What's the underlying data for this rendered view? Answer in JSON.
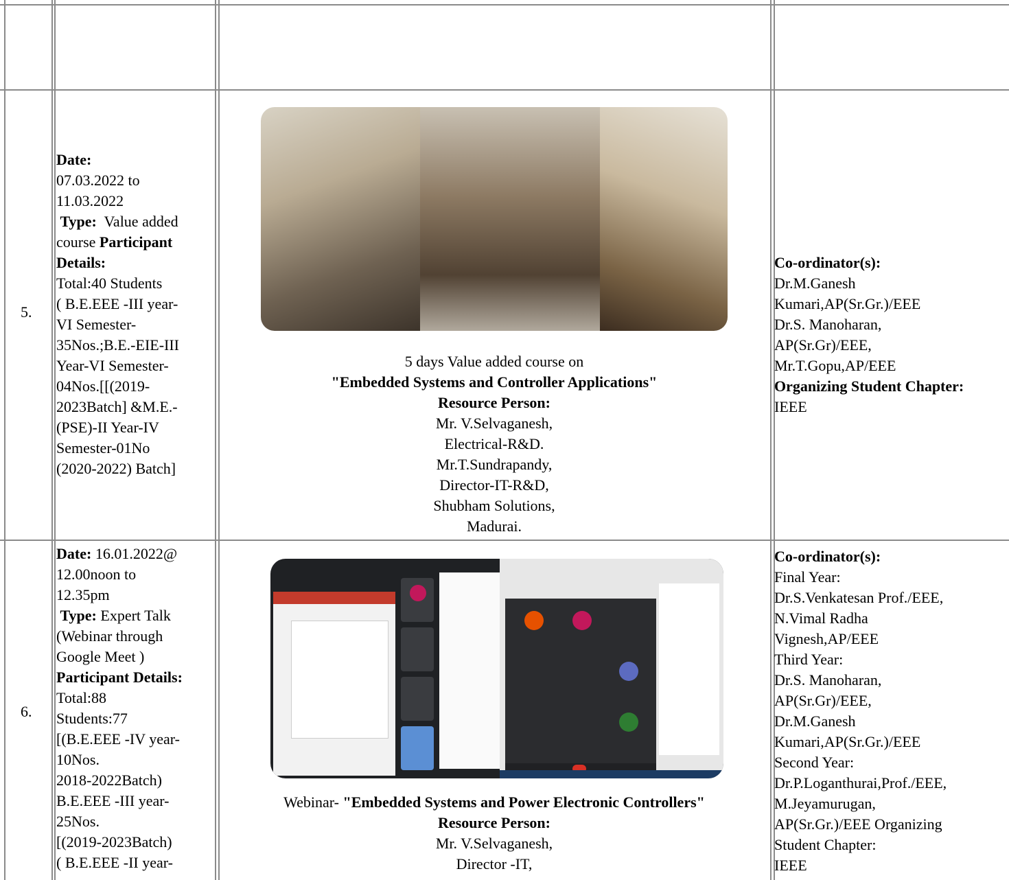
{
  "rows": [
    {
      "sno": "5.",
      "details": {
        "date_label": "Date:",
        "date_lines": [
          "07.03.2022 to",
          "11.03.2022"
        ],
        "type_label": "Type:",
        "type_value": "Value added course",
        "participant_label": "Participant Details:",
        "participant_lines": [
          "Total:40 Students",
          "( B.E.EEE -III year-",
          "VI Semester-",
          "35Nos.;B.E.-EIE-III",
          "Year-VI Semester-",
          "04Nos.[[(2019-",
          "2023Batch] &M.E.-",
          "(PSE)-II Year-IV",
          "Semester-01No",
          "(2020-2022) Batch]"
        ]
      },
      "event": {
        "intro": "5 days Value added course on",
        "title": "\"Embedded Systems and Controller Applications\"",
        "resource_label": "Resource Person:",
        "resource_lines": [
          "Mr. V.Selvaganesh,",
          "Electrical-R&D.",
          "Mr.T.Sundrapandy,",
          "Director-IT-R&D,",
          "Shubham Solutions,",
          "Madurai."
        ]
      },
      "coordinator": {
        "label": "Co-ordinator(s):",
        "lines": [
          "Dr.M.Ganesh",
          "Kumari,AP(Sr.Gr.)/EEE",
          "Dr.S. Manoharan,",
          "AP(Sr.Gr)/EEE,",
          "Mr.T.Gopu,AP/EEE"
        ],
        "chapter_label": "Organizing Student Chapter:",
        "chapter_value": "IEEE"
      }
    },
    {
      "sno": "6.",
      "details": {
        "date_label": "Date:",
        "date_value": "16.01.2022@",
        "date_lines": [
          "12.00noon to",
          "12.35pm"
        ],
        "type_label": "Type:",
        "type_value": "Expert Talk",
        "type_lines": [
          "(Webinar through",
          "Google Meet )"
        ],
        "participant_label": "Participant Details:",
        "participant_lines": [
          "Total:88",
          "Students:77",
          "[(B.E.EEE -IV year-",
          "10Nos.",
          "2018-2022Batch)",
          "B.E.EEE -III year-",
          "25Nos.",
          "[(2019-2023Batch)",
          "( B.E.EEE -II year-"
        ]
      },
      "event": {
        "intro": "Webinar-",
        "title": "\"Embedded Systems and Power Electronic Controllers\"",
        "resource_label": "Resource Person:",
        "resource_lines": [
          "Mr. V.Selvaganesh,",
          "Director -IT,"
        ]
      },
      "coordinator": {
        "label": "Co-ordinator(s):",
        "lines": [
          "Final Year:",
          "Dr.S.Venkatesan Prof./EEE,",
          "N.Vimal Radha",
          "Vignesh,AP/EEE",
          "Third Year:",
          "Dr.S. Manoharan,",
          "AP(Sr.Gr)/EEE,",
          "Dr.M.Ganesh",
          "Kumari,AP(Sr.Gr.)/EEE",
          "Second Year:",
          "Dr.P.Loganthurai,Prof./EEE,",
          "M.Jeyamurugan,",
          "AP(Sr.Gr.)/EEE Organizing",
          "Student Chapter:",
          "IEEE"
        ]
      }
    }
  ]
}
